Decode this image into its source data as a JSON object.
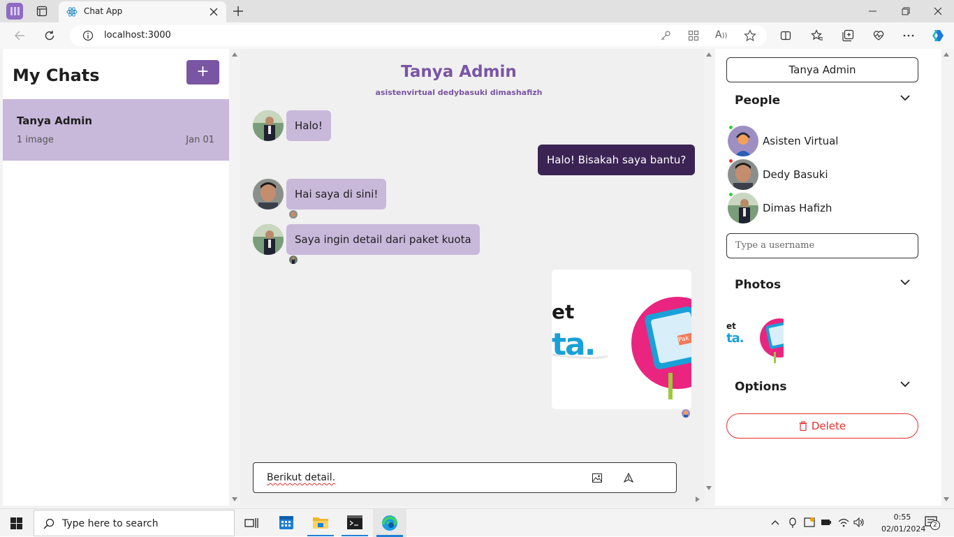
{
  "browser": {
    "tab_title": "Chat App",
    "url": "localhost:3000"
  },
  "left": {
    "title": "My Chats",
    "add_label": "+",
    "chats": [
      {
        "title": "Tanya Admin",
        "subtitle": "1 image",
        "date": "Jan 01"
      }
    ]
  },
  "chat": {
    "title": "Tanya Admin",
    "subtitle": "asistenvirtual dedybasuki dimashafizh",
    "messages": [
      {
        "side": "in",
        "text": "Halo!"
      },
      {
        "side": "out",
        "text": "Halo! Bisakah saya bantu?"
      },
      {
        "side": "in",
        "text": "Hai saya di sini!"
      },
      {
        "side": "in",
        "text": "Saya ingin detail dari paket kuota"
      }
    ],
    "image_text": {
      "line1": "et",
      "line2": "ta.",
      "badge": "Pak"
    },
    "composer_value": "Berikut detail."
  },
  "right": {
    "title": "Tanya Admin",
    "people_label": "People",
    "people": [
      {
        "name": "Asisten Virtual",
        "status_color": "#2ecc40"
      },
      {
        "name": "Dedy Basuki",
        "status_color": "#e62e2e"
      },
      {
        "name": "Dimas Hafizh",
        "status_color": "#2ecc40"
      }
    ],
    "username_placeholder": "Type a username",
    "photos_label": "Photos",
    "options_label": "Options",
    "delete_label": "Delete"
  },
  "taskbar": {
    "search_placeholder": "Type here to search",
    "time": "0:55",
    "date": "02/01/2024",
    "notifications": "2"
  },
  "colors": {
    "accent": "#7a55a3",
    "bubble_in": "#c8b8da",
    "bubble_out": "#3b2454",
    "danger": "#e62e2e"
  }
}
